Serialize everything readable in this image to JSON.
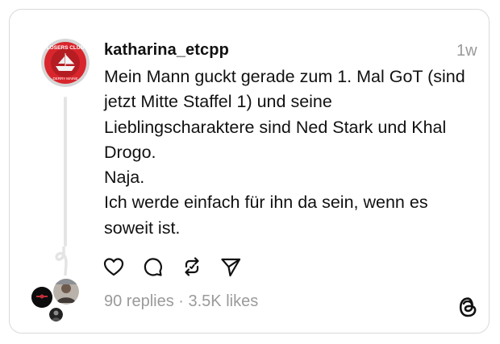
{
  "post": {
    "username": "katharina_etcpp",
    "time": "1w",
    "lines": [
      "Mein Mann guckt gerade zum 1. Mal GoT (sind",
      "jetzt Mitte Staffel 1) und seine",
      "Lieblingscharaktere sind Ned Stark und Khal",
      "Drogo.",
      "Naja.",
      "Ich werde einfach für ihn da sein, wenn es",
      "soweit ist."
    ]
  },
  "stats": {
    "replies": "90 replies",
    "separator": " · ",
    "likes": "3.5K likes"
  },
  "avatar": {
    "badge_top": "LOSERS CLUB",
    "badge_bottom": "DERRY MAINE"
  },
  "actions": {
    "icons": [
      "heart-icon",
      "comment-icon",
      "repost-icon",
      "share-icon"
    ]
  },
  "colors": {
    "text": "#111111",
    "muted": "#9a9a9a",
    "border": "#d9d9d9",
    "badge_red": "#d9262c"
  }
}
